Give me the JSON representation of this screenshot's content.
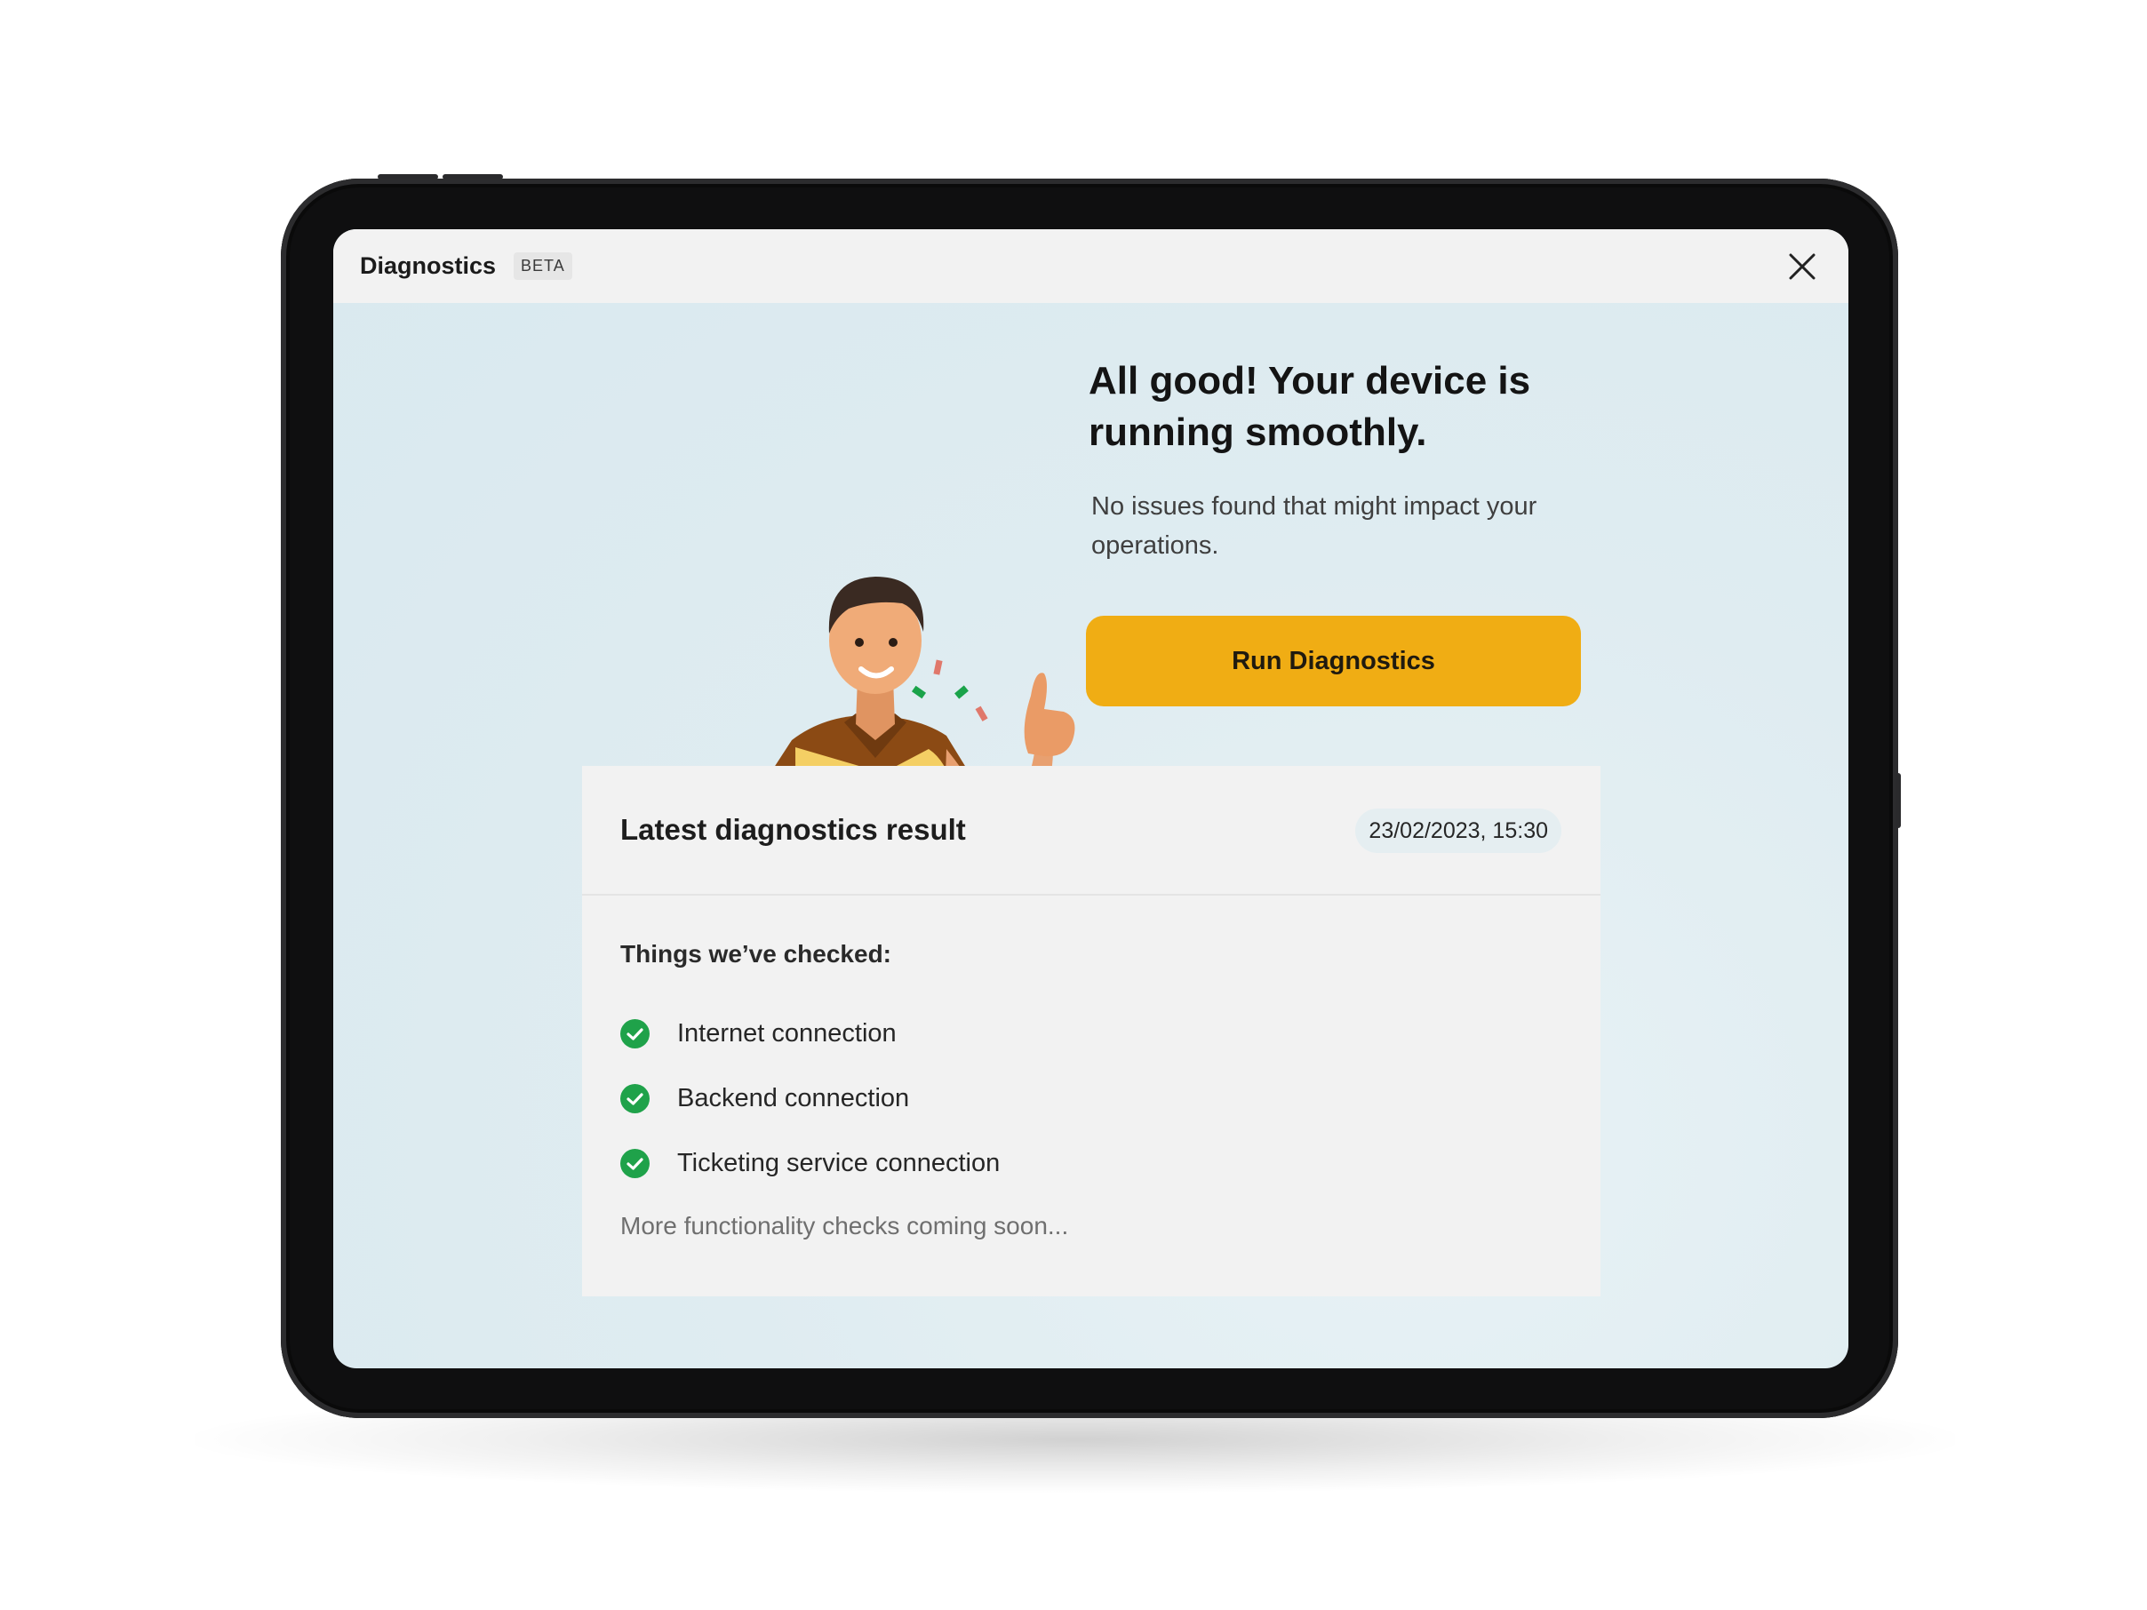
{
  "header": {
    "title": "Diagnostics",
    "badge": "BETA"
  },
  "hero": {
    "title": "All good! Your device is running smoothly.",
    "subtitle": "No issues found that might impact your operations.",
    "run_button_label": "Run Diagnostics"
  },
  "result": {
    "title": "Latest diagnostics result",
    "timestamp": "23/02/2023, 15:30",
    "checked_heading": "Things we’ve checked:",
    "checks": [
      {
        "label": "Internet connection",
        "status": "passed"
      },
      {
        "label": "Backend connection",
        "status": "passed"
      },
      {
        "label": "Ticketing service connection",
        "status": "passed"
      }
    ],
    "more_note": "More functionality checks coming soon..."
  },
  "colors": {
    "accent": "#f0ad14",
    "success": "#1fa24a",
    "screen_bg": "#dfecf1",
    "card_bg": "#f2f2f2"
  },
  "icons": {
    "close": "close-icon",
    "check": "check-circle-icon"
  }
}
